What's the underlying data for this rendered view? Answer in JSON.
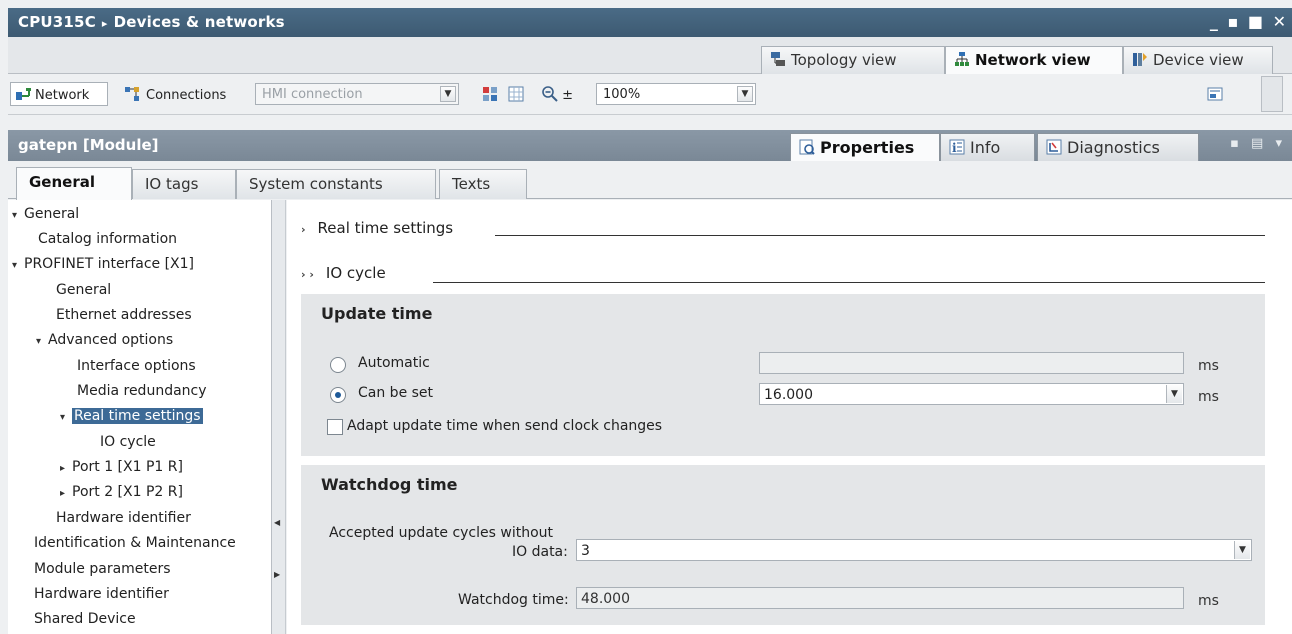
{
  "window": {
    "breadcrumb_root": "CPU315C",
    "breadcrumb_sep": "▸",
    "breadcrumb_page": "Devices & networks",
    "controls": "_ ▪ ■ ✕"
  },
  "view_tabs": [
    {
      "label": "Topology view",
      "icon": "topology-icon"
    },
    {
      "label": "Network view",
      "icon": "network-icon",
      "active": true
    },
    {
      "label": "Device view",
      "icon": "device-icon"
    }
  ],
  "toolbar": {
    "network_label": "Network",
    "connections_label": "Connections",
    "connection_type_value": "HMI connection",
    "zoom_value": "100%",
    "zoom_arrow": "±"
  },
  "properties": {
    "module_title": "gatepn [Module]",
    "tabs": [
      {
        "label": "Properties",
        "icon": "properties-icon",
        "active": true
      },
      {
        "label": "Info",
        "icon": "info-icon"
      },
      {
        "label": "Diagnostics",
        "icon": "diagnostics-icon"
      }
    ],
    "header_controls": "▪ ▤ ▾"
  },
  "general_tabs": [
    {
      "label": "General",
      "active": true
    },
    {
      "label": "IO tags"
    },
    {
      "label": "System constants"
    },
    {
      "label": "Texts"
    }
  ],
  "tree": [
    {
      "label": "General",
      "toggle": "▾",
      "level": 0
    },
    {
      "label": "Catalog information",
      "toggle": "",
      "level": 1
    },
    {
      "label": "PROFINET interface [X1]",
      "toggle": "▾",
      "level": 0
    },
    {
      "label": "General",
      "toggle": "",
      "level": 1
    },
    {
      "label": "Ethernet addresses",
      "toggle": "",
      "level": 1
    },
    {
      "label": "Advanced options",
      "toggle": "▾",
      "level": 1
    },
    {
      "label": "Interface options",
      "toggle": "",
      "level": 2
    },
    {
      "label": "Media redundancy",
      "toggle": "",
      "level": 2
    },
    {
      "label": "Real time settings",
      "toggle": "▾",
      "level": 2,
      "selected": true
    },
    {
      "label": "IO cycle",
      "toggle": "",
      "level": 3
    },
    {
      "label": "Port 1 [X1 P1 R]",
      "toggle": "▸",
      "level": 2
    },
    {
      "label": "Port 2 [X1 P2 R]",
      "toggle": "▸",
      "level": 2
    },
    {
      "label": "Hardware identifier",
      "toggle": "",
      "level": 1
    },
    {
      "label": "Identification & Maintenance",
      "toggle": "",
      "level": 0
    },
    {
      "label": "Module parameters",
      "toggle": "",
      "level": 0
    },
    {
      "label": "Hardware identifier",
      "toggle": "",
      "level": 0
    },
    {
      "label": "Shared Device",
      "toggle": "",
      "level": 0
    }
  ],
  "content": {
    "section_real_time": "Real time settings",
    "section_real_time_chevron": "›",
    "section_io_cycle": "IO cycle",
    "section_io_cycle_chevron": "› ›",
    "update_time": {
      "title": "Update time",
      "automatic_label": "Automatic",
      "automatic_value": "",
      "automatic_unit": "ms",
      "can_be_set_label": "Can be set",
      "can_be_set_value": "16.000",
      "can_be_set_unit": "ms",
      "selected_option": "Can be set",
      "adapt_label": "Adapt update time when send clock changes",
      "adapt_checked": false
    },
    "watchdog_time": {
      "title": "Watchdog time",
      "accepted_cycles_label_line1": "Accepted update cycles without",
      "accepted_cycles_label_line2": "IO data:",
      "accepted_cycles_value": "3",
      "watchdog_label": "Watchdog time:",
      "watchdog_value": "48.000",
      "watchdog_unit": "ms"
    }
  }
}
